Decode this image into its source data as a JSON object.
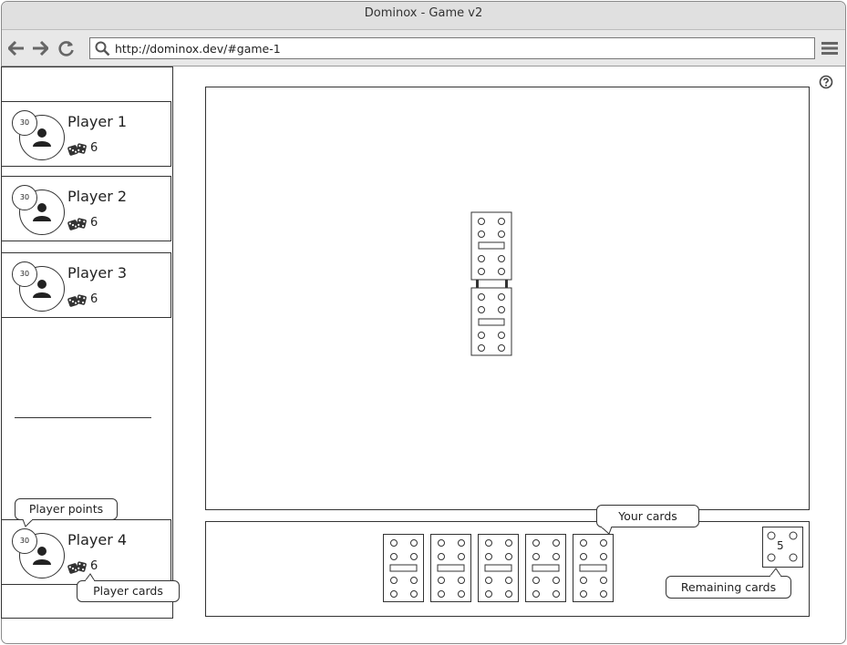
{
  "window": {
    "title": "Dominox - Game v2"
  },
  "browser": {
    "url": "http://dominox.dev/#game-1"
  },
  "players": [
    {
      "name": "Player 1",
      "points": "30",
      "cards": "6"
    },
    {
      "name": "Player 2",
      "points": "30",
      "cards": "6"
    },
    {
      "name": "Player 3",
      "points": "30",
      "cards": "6"
    },
    {
      "name": "Player 4",
      "points": "30",
      "cards": "6"
    }
  ],
  "callouts": {
    "player_points": "Player points",
    "player_cards": "Player cards",
    "your_cards": "Your cards",
    "remaining_cards": "Remaining cards"
  },
  "board": {
    "played_dominoes": [
      [
        4,
        4
      ],
      [
        4,
        4
      ]
    ]
  },
  "hand": {
    "dominoes": [
      [
        4,
        4
      ],
      [
        4,
        4
      ],
      [
        4,
        4
      ],
      [
        4,
        4
      ],
      [
        4,
        4
      ]
    ]
  },
  "remaining": {
    "count": "5"
  },
  "icons": [
    "back-icon",
    "forward-icon",
    "reload-icon",
    "search-icon",
    "menu-icon",
    "help-icon",
    "user-icon",
    "dice-icon"
  ]
}
